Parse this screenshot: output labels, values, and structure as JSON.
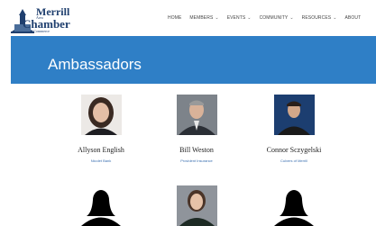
{
  "logo": {
    "line1": "Merrill",
    "line2": "Area",
    "line3": "Chamber",
    "line4": "of Commerce"
  },
  "nav": {
    "items": [
      {
        "label": "HOME",
        "has_menu": false
      },
      {
        "label": "MEMBERS",
        "has_menu": true
      },
      {
        "label": "EVENTS",
        "has_menu": true
      },
      {
        "label": "COMMUNITY",
        "has_menu": true
      },
      {
        "label": "RESOURCES",
        "has_menu": true
      },
      {
        "label": "ABOUT",
        "has_menu": false
      }
    ]
  },
  "hero": {
    "title": "Ambassadors"
  },
  "ambassadors": [
    {
      "name": "Allyson English",
      "company": "Nicolet Bank"
    },
    {
      "name": "Bill Weston",
      "company": "Provident Insurance"
    },
    {
      "name": "Connor Sczygelski",
      "company": "Culvers of Merrill"
    }
  ],
  "colors": {
    "hero": "#2f7fc6",
    "brand": "#1f3f6e",
    "company_link": "#3a6fb0"
  }
}
